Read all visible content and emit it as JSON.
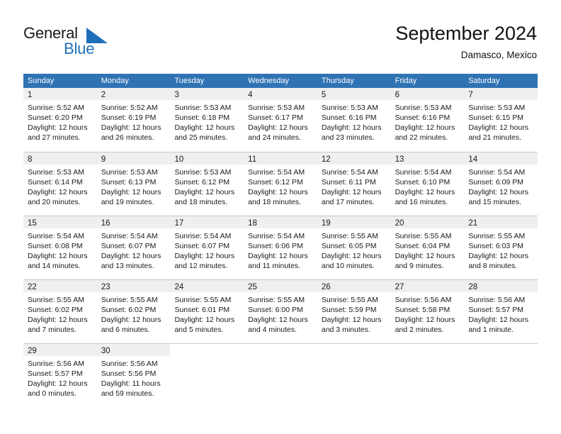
{
  "brand": {
    "name_part1": "General",
    "name_part2": "Blue",
    "accent_color": "#1f6fb8"
  },
  "header": {
    "title": "September 2024",
    "subtitle": "Damasco, Mexico"
  },
  "theme": {
    "header_blue": "#3073b4",
    "daynum_band": "#efefef",
    "grid_line": "#c8c8c8"
  },
  "weekdays": [
    "Sunday",
    "Monday",
    "Tuesday",
    "Wednesday",
    "Thursday",
    "Friday",
    "Saturday"
  ],
  "weeks": [
    {
      "days": [
        {
          "num": "1",
          "sunrise": "Sunrise: 5:52 AM",
          "sunset": "Sunset: 6:20 PM",
          "daylight": "Daylight: 12 hours and 27 minutes."
        },
        {
          "num": "2",
          "sunrise": "Sunrise: 5:52 AM",
          "sunset": "Sunset: 6:19 PM",
          "daylight": "Daylight: 12 hours and 26 minutes."
        },
        {
          "num": "3",
          "sunrise": "Sunrise: 5:53 AM",
          "sunset": "Sunset: 6:18 PM",
          "daylight": "Daylight: 12 hours and 25 minutes."
        },
        {
          "num": "4",
          "sunrise": "Sunrise: 5:53 AM",
          "sunset": "Sunset: 6:17 PM",
          "daylight": "Daylight: 12 hours and 24 minutes."
        },
        {
          "num": "5",
          "sunrise": "Sunrise: 5:53 AM",
          "sunset": "Sunset: 6:16 PM",
          "daylight": "Daylight: 12 hours and 23 minutes."
        },
        {
          "num": "6",
          "sunrise": "Sunrise: 5:53 AM",
          "sunset": "Sunset: 6:16 PM",
          "daylight": "Daylight: 12 hours and 22 minutes."
        },
        {
          "num": "7",
          "sunrise": "Sunrise: 5:53 AM",
          "sunset": "Sunset: 6:15 PM",
          "daylight": "Daylight: 12 hours and 21 minutes."
        }
      ]
    },
    {
      "days": [
        {
          "num": "8",
          "sunrise": "Sunrise: 5:53 AM",
          "sunset": "Sunset: 6:14 PM",
          "daylight": "Daylight: 12 hours and 20 minutes."
        },
        {
          "num": "9",
          "sunrise": "Sunrise: 5:53 AM",
          "sunset": "Sunset: 6:13 PM",
          "daylight": "Daylight: 12 hours and 19 minutes."
        },
        {
          "num": "10",
          "sunrise": "Sunrise: 5:53 AM",
          "sunset": "Sunset: 6:12 PM",
          "daylight": "Daylight: 12 hours and 18 minutes."
        },
        {
          "num": "11",
          "sunrise": "Sunrise: 5:54 AM",
          "sunset": "Sunset: 6:12 PM",
          "daylight": "Daylight: 12 hours and 18 minutes."
        },
        {
          "num": "12",
          "sunrise": "Sunrise: 5:54 AM",
          "sunset": "Sunset: 6:11 PM",
          "daylight": "Daylight: 12 hours and 17 minutes."
        },
        {
          "num": "13",
          "sunrise": "Sunrise: 5:54 AM",
          "sunset": "Sunset: 6:10 PM",
          "daylight": "Daylight: 12 hours and 16 minutes."
        },
        {
          "num": "14",
          "sunrise": "Sunrise: 5:54 AM",
          "sunset": "Sunset: 6:09 PM",
          "daylight": "Daylight: 12 hours and 15 minutes."
        }
      ]
    },
    {
      "days": [
        {
          "num": "15",
          "sunrise": "Sunrise: 5:54 AM",
          "sunset": "Sunset: 6:08 PM",
          "daylight": "Daylight: 12 hours and 14 minutes."
        },
        {
          "num": "16",
          "sunrise": "Sunrise: 5:54 AM",
          "sunset": "Sunset: 6:07 PM",
          "daylight": "Daylight: 12 hours and 13 minutes."
        },
        {
          "num": "17",
          "sunrise": "Sunrise: 5:54 AM",
          "sunset": "Sunset: 6:07 PM",
          "daylight": "Daylight: 12 hours and 12 minutes."
        },
        {
          "num": "18",
          "sunrise": "Sunrise: 5:54 AM",
          "sunset": "Sunset: 6:06 PM",
          "daylight": "Daylight: 12 hours and 11 minutes."
        },
        {
          "num": "19",
          "sunrise": "Sunrise: 5:55 AM",
          "sunset": "Sunset: 6:05 PM",
          "daylight": "Daylight: 12 hours and 10 minutes."
        },
        {
          "num": "20",
          "sunrise": "Sunrise: 5:55 AM",
          "sunset": "Sunset: 6:04 PM",
          "daylight": "Daylight: 12 hours and 9 minutes."
        },
        {
          "num": "21",
          "sunrise": "Sunrise: 5:55 AM",
          "sunset": "Sunset: 6:03 PM",
          "daylight": "Daylight: 12 hours and 8 minutes."
        }
      ]
    },
    {
      "days": [
        {
          "num": "22",
          "sunrise": "Sunrise: 5:55 AM",
          "sunset": "Sunset: 6:02 PM",
          "daylight": "Daylight: 12 hours and 7 minutes."
        },
        {
          "num": "23",
          "sunrise": "Sunrise: 5:55 AM",
          "sunset": "Sunset: 6:02 PM",
          "daylight": "Daylight: 12 hours and 6 minutes."
        },
        {
          "num": "24",
          "sunrise": "Sunrise: 5:55 AM",
          "sunset": "Sunset: 6:01 PM",
          "daylight": "Daylight: 12 hours and 5 minutes."
        },
        {
          "num": "25",
          "sunrise": "Sunrise: 5:55 AM",
          "sunset": "Sunset: 6:00 PM",
          "daylight": "Daylight: 12 hours and 4 minutes."
        },
        {
          "num": "26",
          "sunrise": "Sunrise: 5:55 AM",
          "sunset": "Sunset: 5:59 PM",
          "daylight": "Daylight: 12 hours and 3 minutes."
        },
        {
          "num": "27",
          "sunrise": "Sunrise: 5:56 AM",
          "sunset": "Sunset: 5:58 PM",
          "daylight": "Daylight: 12 hours and 2 minutes."
        },
        {
          "num": "28",
          "sunrise": "Sunrise: 5:56 AM",
          "sunset": "Sunset: 5:57 PM",
          "daylight": "Daylight: 12 hours and 1 minute."
        }
      ]
    },
    {
      "days": [
        {
          "num": "29",
          "sunrise": "Sunrise: 5:56 AM",
          "sunset": "Sunset: 5:57 PM",
          "daylight": "Daylight: 12 hours and 0 minutes."
        },
        {
          "num": "30",
          "sunrise": "Sunrise: 5:56 AM",
          "sunset": "Sunset: 5:56 PM",
          "daylight": "Daylight: 11 hours and 59 minutes."
        },
        null,
        null,
        null,
        null,
        null
      ]
    }
  ]
}
